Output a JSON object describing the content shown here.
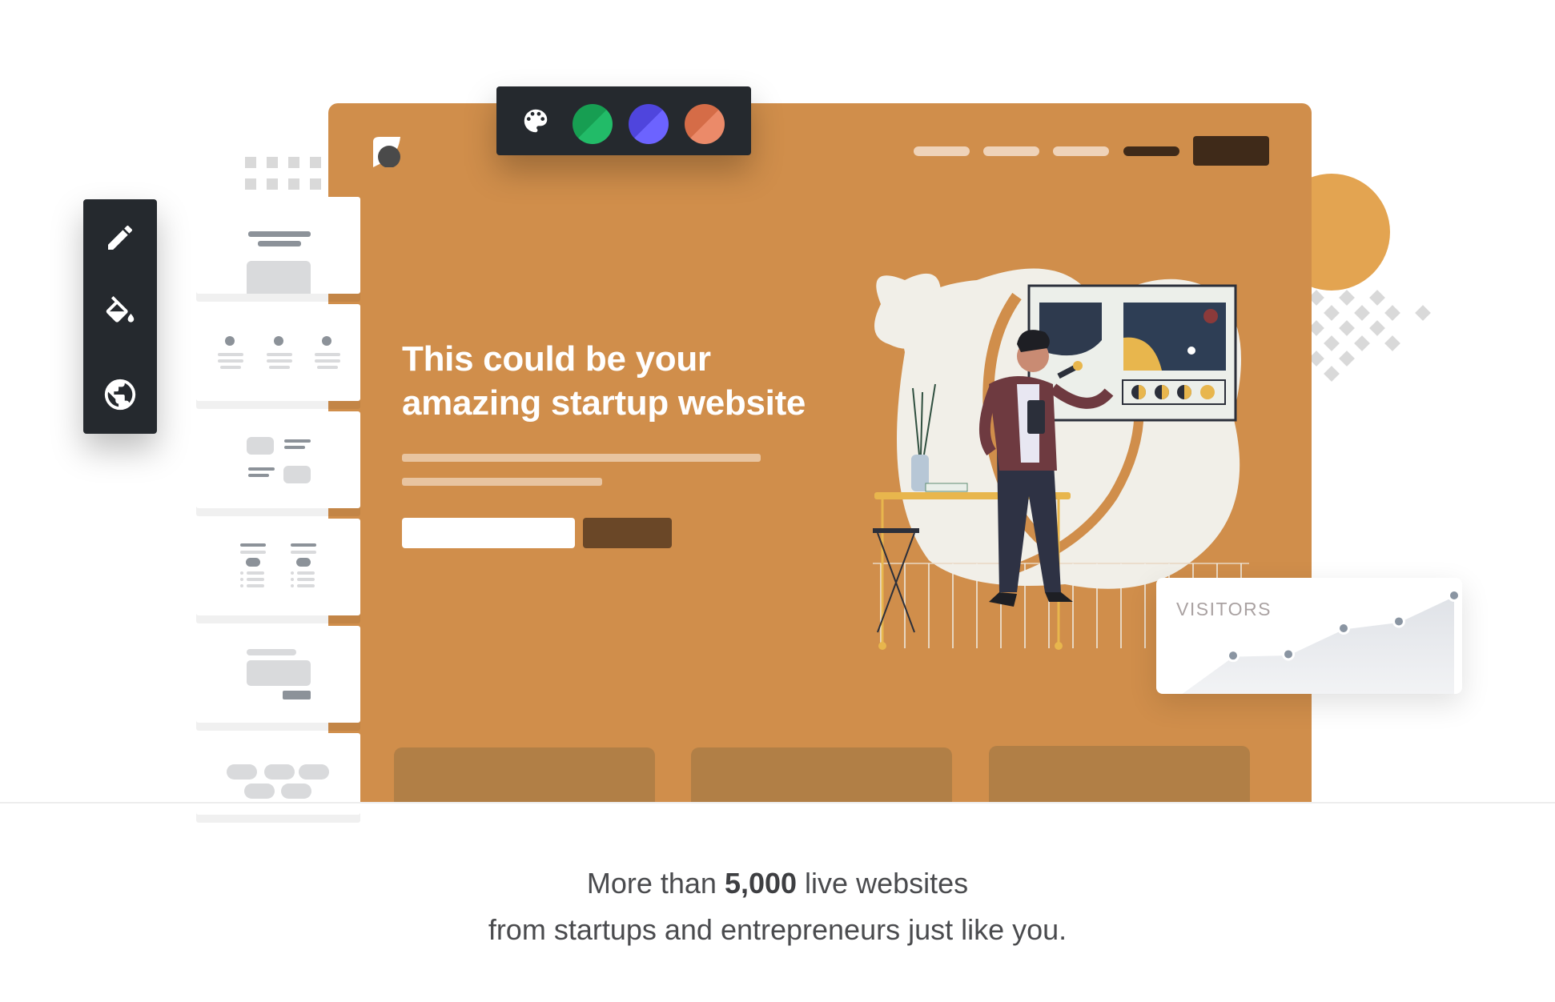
{
  "palette": {
    "icon": "palette-icon",
    "swatches": [
      {
        "name": "green",
        "dark": "#179E52",
        "light": "#22BB68"
      },
      {
        "name": "indigo",
        "dark": "#4F45DD",
        "light": "#6C63FF"
      },
      {
        "name": "coral",
        "dark": "#D56C47",
        "light": "#EB8A69"
      }
    ]
  },
  "tool_rail": {
    "tools": [
      {
        "icon": "pencil-icon",
        "label": "Edit"
      },
      {
        "icon": "paint-bucket-icon",
        "label": "Fill"
      },
      {
        "icon": "globe-icon",
        "label": "Publish"
      }
    ]
  },
  "site_preview": {
    "brand_color": "#D08E4B",
    "hero_title_line1": "This could be your",
    "hero_title_line2": "amazing startup website",
    "nav_items": 4,
    "feature_boxes": 3
  },
  "section_thumbnails": [
    {
      "type": "header-hero"
    },
    {
      "type": "features-three-column"
    },
    {
      "type": "alternating-media"
    },
    {
      "type": "pricing-two-column"
    },
    {
      "type": "call-to-action"
    },
    {
      "type": "tags-cloud"
    }
  ],
  "visitors_widget": {
    "label": "VISITORS",
    "chart_data": {
      "type": "area",
      "title": "VISITORS",
      "x": [
        1,
        2,
        3,
        4,
        5,
        6
      ],
      "values": [
        0,
        28,
        29,
        48,
        53,
        72
      ]
    }
  },
  "footer": {
    "line1_prefix": "More than ",
    "line1_count": "5,000",
    "line1_suffix": " live websites",
    "line2": "from startups and entrepreneurs just like you."
  }
}
